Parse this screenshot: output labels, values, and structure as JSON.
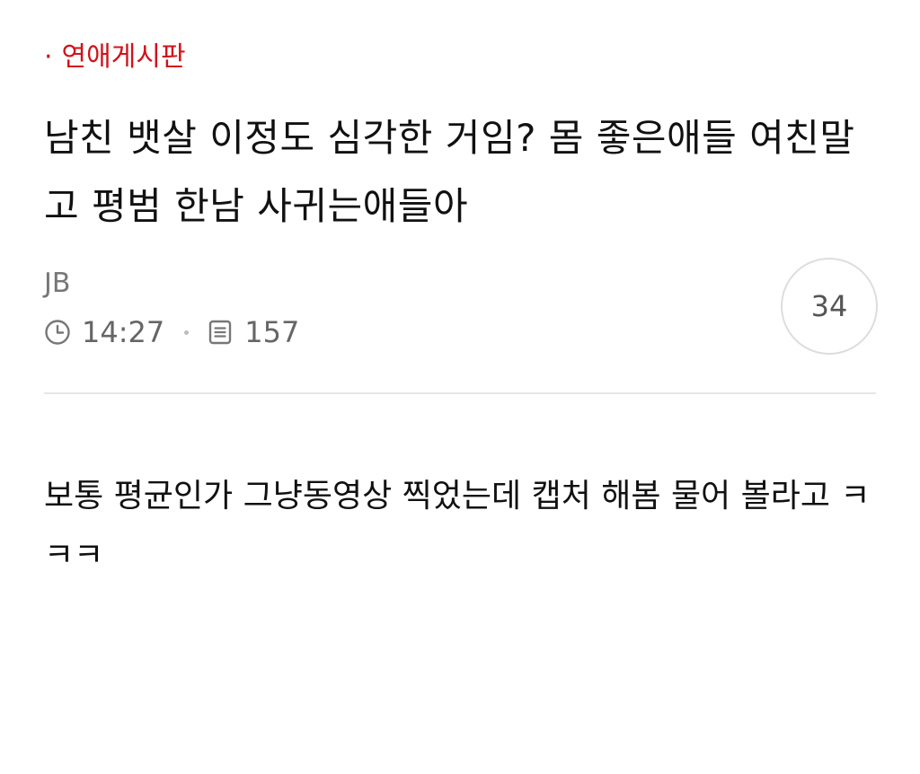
{
  "board": {
    "bullet": "·",
    "name": "연애게시판"
  },
  "post": {
    "title": "남친 뱃살 이정도 심각한 거임? 몸 좋은애들 여친말고 평범 한남 사귀는애들아",
    "author": "JB",
    "time": "14:27",
    "views": "157",
    "comment_count": "34",
    "body": "보통 평균인가 그냥동영상 찍었는데 캡처 해봄 물어 볼라고 ㅋㅋㅋ"
  },
  "icons": {
    "time": "clock-icon",
    "views": "document-icon"
  },
  "colors": {
    "board_accent": "#d0121b",
    "meta_text": "#666666",
    "divider": "#e6e6e6"
  }
}
